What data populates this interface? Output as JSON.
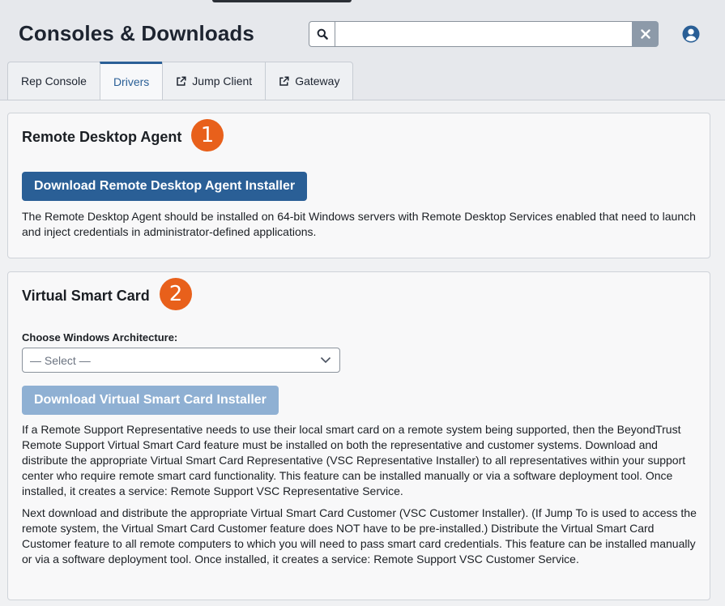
{
  "header": {
    "title": "Consoles & Downloads",
    "search_placeholder": "",
    "search_value": "",
    "search_icon": "search-icon",
    "clear_icon": "close-icon",
    "user_icon": "user-circle-icon"
  },
  "tabs": [
    {
      "label": "Rep Console",
      "icon": "",
      "active": false
    },
    {
      "label": "Drivers",
      "icon": "",
      "active": true
    },
    {
      "label": "Jump Client",
      "icon": "external-link-icon",
      "active": false
    },
    {
      "label": "Gateway",
      "icon": "external-link-icon",
      "active": false
    }
  ],
  "sections": {
    "rda": {
      "title": "Remote Desktop Agent",
      "badge": "1",
      "button": "Download Remote Desktop Agent Installer",
      "description": "The Remote Desktop Agent should be installed on 64-bit Windows servers with Remote Desktop Services enabled that need to launch and inject credentials in administrator-defined applications."
    },
    "vsc": {
      "title": "Virtual Smart Card",
      "badge": "2",
      "arch_label": "Choose Windows Architecture:",
      "arch_selected": "— Select —",
      "button": "Download Virtual Smart Card Installer",
      "description1": "If a Remote Support Representative needs to use their local smart card on a remote system being supported, then the BeyondTrust Remote Support Virtual Smart Card feature must be installed on both the representative and customer systems. Download and distribute the appropriate Virtual Smart Card Representative (VSC Representative Installer) to all representatives within your support center who require remote smart card functionality. This feature can be installed manually or via a software deployment tool. Once installed, it creates a service: Remote Support VSC Representative Service.",
      "description2": "Next download and distribute the appropriate Virtual Smart Card Customer (VSC Customer Installer). (If Jump To is used to access the remote system, the Virtual Smart Card Customer feature does NOT have to be pre-installed.) Distribute the Virtual Smart Card Customer feature to all remote computers to which you will need to pass smart card credentials. This feature can be installed manually or via a software deployment tool. Once installed, it creates a service: Remote Support VSC Customer Service."
    }
  },
  "colors": {
    "primary": "#2a5f96",
    "primary_disabled": "#8fb0d3",
    "badge": "#e8601b"
  }
}
